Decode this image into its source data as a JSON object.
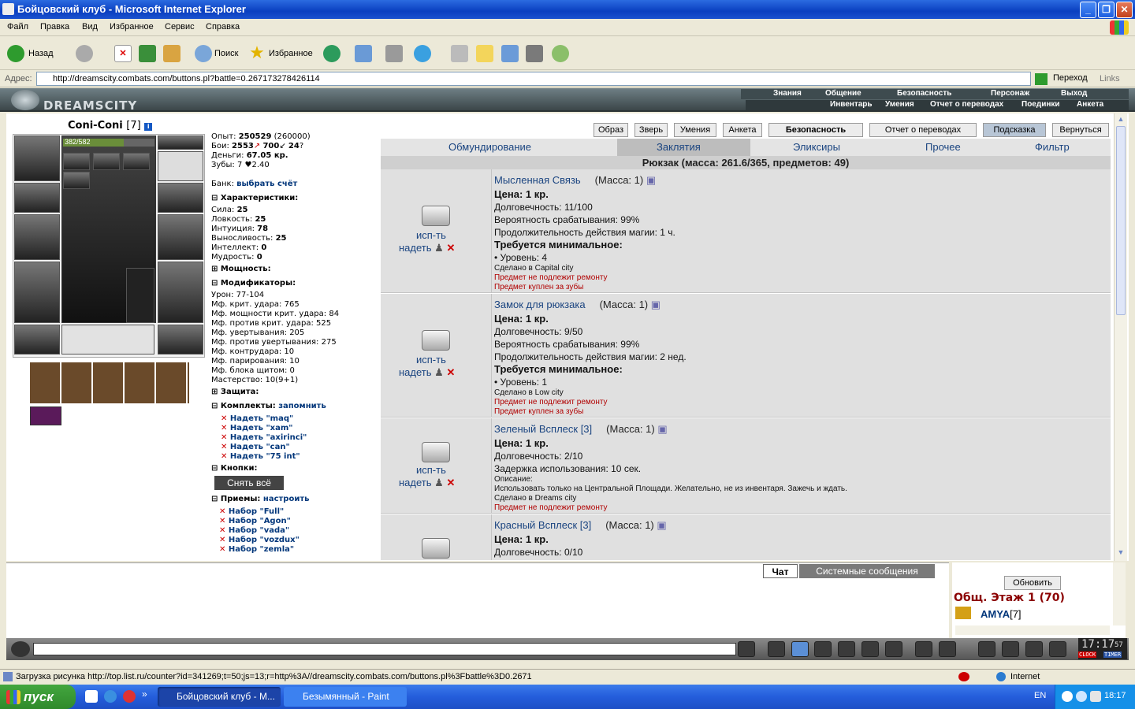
{
  "window": {
    "title": "Бойцовский клуб - Microsoft Internet Explorer"
  },
  "menu": [
    "Файл",
    "Правка",
    "Вид",
    "Избранное",
    "Сервис",
    "Справка"
  ],
  "toolbar": {
    "back": "Назад",
    "search": "Поиск",
    "favorites": "Избранное"
  },
  "address": {
    "label": "Адрес:",
    "url": "http://dreamscity.combats.com/buttons.pl?battle=0.267173278426114",
    "go": "Переход",
    "links": "Links"
  },
  "game": {
    "logo": "DREAMSCITY",
    "nav_top": [
      "Знания",
      "Общение",
      "Безопасность",
      "Персонаж",
      "Выход"
    ],
    "nav_sub": [
      "Инвентарь",
      "Умения",
      "Отчет о переводах",
      "Поединки",
      "Анкета"
    ]
  },
  "character": {
    "name": "Coni-Coni",
    "level": "[7]",
    "hp": "382/582",
    "exp_label": "Опыт:",
    "exp": "250529",
    "exp_next": "(260000)",
    "fights_label": "Бои:",
    "wins": "2553",
    "losses": "700",
    "draws": "24",
    "money_label": "Деньги:",
    "money": "67.05 кр.",
    "teeth_label": "Зубы:",
    "teeth": "7 ♥2.40",
    "bank_label": "Банк:",
    "bank_link": "выбрать счёт"
  },
  "characteristics": {
    "title": "Характеристики:",
    "items": [
      "Сила:",
      "Ловкость:",
      "Интуиция:",
      "Выносливость:",
      "Интеллект:",
      "Мудрость:"
    ],
    "values": [
      "25",
      "25",
      "78",
      "25",
      "0",
      "0"
    ]
  },
  "power_title": "Мощность:",
  "modifiers": {
    "title": "Модификаторы:",
    "items": [
      "Урон: 77-104",
      "Мф. крит. удара: 765",
      "Мф. мощности крит. удара: 84",
      "Мф. против крит. удара: 525",
      "Мф. увертывания: 205",
      "Мф. против увертывания: 275",
      "Мф. контрудара: 10",
      "Мф. парирования: 10",
      "Мф. блока щитом: 0",
      "Мастерство: 10(9+1)"
    ]
  },
  "defense_title": "Защита:",
  "sets": {
    "title": "Комплекты:",
    "remember": "запомнить",
    "items": [
      "Надеть \"maq\"",
      "Надеть \"xam\"",
      "Надеть \"axirinci\"",
      "Надеть \"can\"",
      "Надеть \"75 int\""
    ]
  },
  "buttons_title": "Кнопки:",
  "remove_all": "Снять всё",
  "priemy": {
    "title": "Приемы:",
    "configure": "настроить",
    "items": [
      "Набор \"Full\"",
      "Набор \"Agon\"",
      "Набор \"vada\"",
      "Набор \"vozdux\"",
      "Набор \"zemla\""
    ]
  },
  "topbuttons": [
    "Образ",
    "Зверь",
    "Умения",
    "Анкета",
    "Безопасность",
    "Отчет о переводах",
    "Подсказка",
    "Вернуться"
  ],
  "tabs": [
    "Обмундирование",
    "Заклятия",
    "Эликсиры",
    "Прочее",
    "Фильтр"
  ],
  "backpack": "Рюкзак (масса: 261.6/365, предметов: 49)",
  "actions": {
    "use": "исп-ть",
    "wear": "надеть"
  },
  "items": [
    {
      "name": "Мысленная Связь",
      "mass": "(Масса: 1)",
      "lines": [
        "Цена: 1 кр.",
        "Долговечность: 11/100",
        "Вероятность срабатывания: 99%",
        "Продолжительность действия магии: 1 ч.",
        "Требуется минимальное:",
        "• Уровень: 4",
        "Сделано в Capital city",
        "Предмет не подлежит ремонту",
        "Предмет куплен за зубы"
      ]
    },
    {
      "name": "Замок для рюкзака",
      "mass": "(Масса: 1)",
      "lines": [
        "Цена: 1 кр.",
        "Долговечность: 9/50",
        "Вероятность срабатывания: 99%",
        "Продолжительность действия магии: 2 нед.",
        "Требуется минимальное:",
        "• Уровень: 1",
        "Сделано в Low city",
        "Предмет не подлежит ремонту",
        "Предмет куплен за зубы"
      ]
    },
    {
      "name": "Зеленый Всплеск [3]",
      "mass": "(Масса: 1)",
      "lines": [
        "Цена: 1 кр.",
        "Долговечность: 2/10",
        "Задержка использования: 10 сек.",
        "Описание:",
        "Использовать только на Центральной Площади. Желательно, не из инвентаря. Зажечь и ждать.",
        "Сделано в Dreams city",
        "Предмет не подлежит ремонту"
      ]
    },
    {
      "name": "Красный Всплеск [3]",
      "mass": "(Масса: 1)",
      "lines": [
        "Цена: 1 кр.",
        "Долговечность: 0/10"
      ]
    }
  ],
  "chat": {
    "tab_chat": "Чат",
    "tab_system": "Системные сообщения"
  },
  "online": {
    "refresh": "Обновить",
    "location": "Общ. Этаж 1 (70)",
    "user": "AMYA",
    "user_level": "[7]"
  },
  "clock": {
    "time": "17:17",
    "sec": "57",
    "clock_label": "CLOCK",
    "timer_label": "TIMER"
  },
  "status": {
    "text": "Загрузка рисунка http://top.list.ru/counter?id=341269;t=50;js=13;r=http%3A//dreamscity.combats.com/buttons.pl%3Fbattle%3D0.2671",
    "zone": "Internet"
  },
  "taskbar": {
    "start": "пуск",
    "tasks": [
      "Бойцовский клуб - M...",
      "Безымянный - Paint"
    ],
    "lang": "EN",
    "time": "18:17"
  }
}
